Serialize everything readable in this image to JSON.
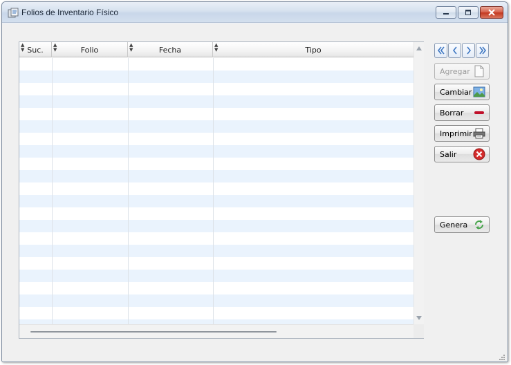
{
  "window": {
    "title": "Folios de Inventario Físico",
    "controls": {
      "minimize": "minimize-icon",
      "maximize": "maximize-icon",
      "close": "close-icon"
    }
  },
  "grid": {
    "columns": [
      {
        "label": "Suc."
      },
      {
        "label": "Folio"
      },
      {
        "label": "Fecha"
      },
      {
        "label": "Tipo"
      }
    ],
    "rows": [],
    "row_stripe_color": "#eaf3fd"
  },
  "navigation": {
    "buttons": [
      "first-record-icon",
      "previous-record-icon",
      "next-record-icon",
      "last-record-icon"
    ]
  },
  "actions": {
    "agregar": {
      "label": "Agregar",
      "enabled": false,
      "icon": "new-document-icon"
    },
    "cambiar": {
      "label": "Cambiar",
      "icon": "picture-edit-icon"
    },
    "borrar": {
      "label": "Borrar",
      "icon": "minus-icon"
    },
    "imprimir": {
      "label": "Imprimir",
      "icon": "printer-icon"
    },
    "salir": {
      "label": "Salir",
      "icon": "close-circle-icon"
    },
    "genera": {
      "label": "Genera",
      "icon": "refresh-arrows-icon"
    }
  },
  "colors": {
    "accent": "#4a7fc1",
    "close_red": "#c3371e",
    "delete_red": "#c0102a"
  }
}
